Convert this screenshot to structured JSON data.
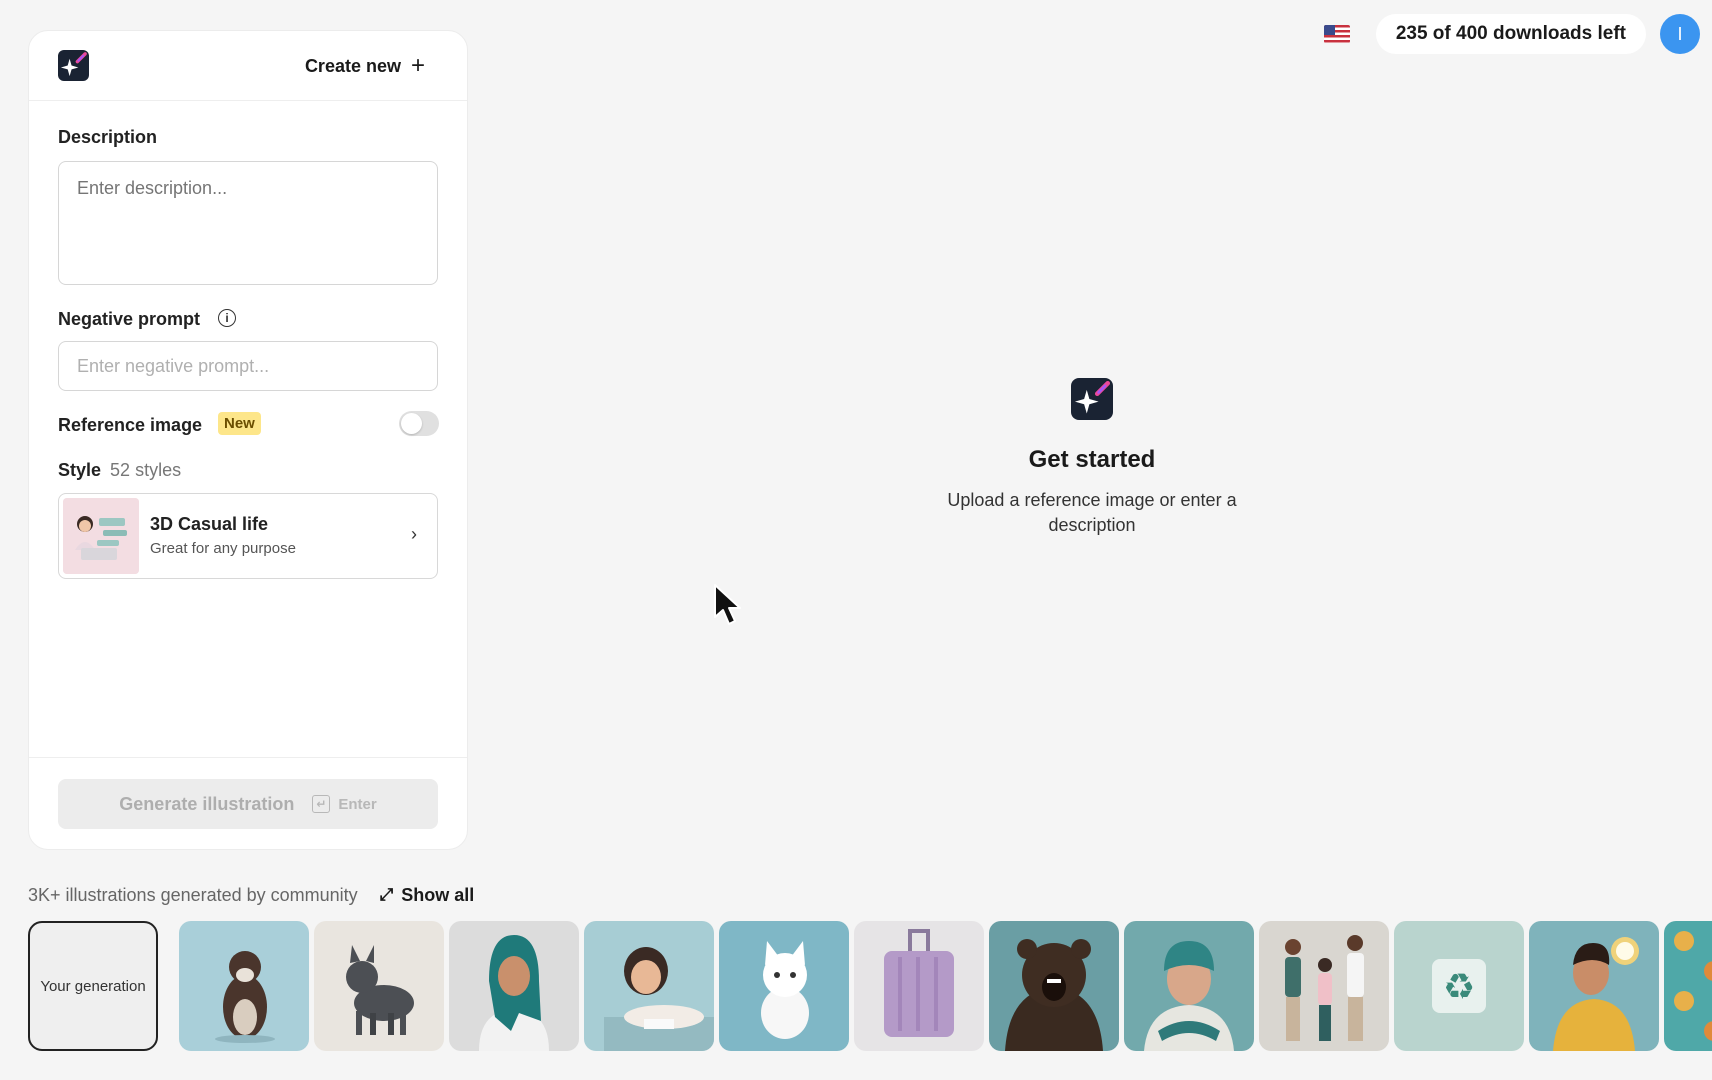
{
  "header": {
    "flag_icon": "us-flag-icon",
    "downloads": "235 of 400 downloads left",
    "avatar_initial": "I"
  },
  "panel": {
    "create_new_label": "Create new",
    "description": {
      "label": "Description",
      "placeholder": "Enter description...",
      "value": ""
    },
    "negative_prompt": {
      "label": "Negative prompt",
      "placeholder": "Enter negative prompt...",
      "value": ""
    },
    "reference_image": {
      "label": "Reference image",
      "badge": "New",
      "enabled": false
    },
    "style": {
      "label": "Style",
      "count": "52 styles",
      "selected_title": "3D Casual life",
      "selected_subtitle": "Great for any purpose"
    },
    "generate_label": "Generate illustration",
    "enter_hint": "Enter"
  },
  "empty_state": {
    "title": "Get started",
    "subtitle": "Upload a reference image or enter a description"
  },
  "community": {
    "text": "3K+ illustrations generated by community",
    "show_all": "Show all",
    "your_generation": "Your generation",
    "thumbnails": [
      "otter",
      "dog",
      "woman-hijab",
      "girl-reading",
      "white-cat",
      "suitcase",
      "bear",
      "elderly-woman",
      "family",
      "recycle",
      "boy-with-clock",
      "pattern"
    ]
  },
  "colors": {
    "accent": "#3b95f0",
    "badge_bg": "#fde68a",
    "logo_bg": "#1a2333",
    "page_bg": "#f5f5f5"
  }
}
